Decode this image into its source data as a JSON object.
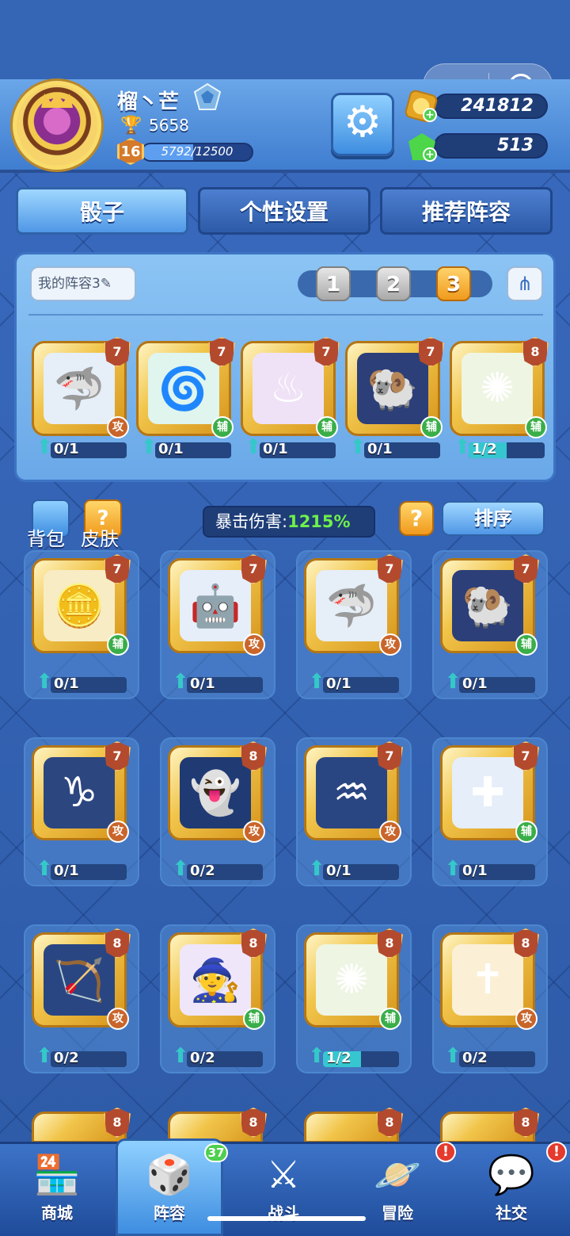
{
  "header": {
    "player_name": "榴丶芒",
    "trophies": "5658",
    "level": "16",
    "xp_text": "5792/12500",
    "xp_fraction": 0.4634,
    "coins": "241812",
    "gems": "513",
    "capsule_dots": "•••"
  },
  "tabs": [
    {
      "label": "骰子"
    },
    {
      "label": "个性设置"
    },
    {
      "label": "推荐阵容"
    }
  ],
  "lineup": {
    "my_lineup_label": "我的阵容3✎",
    "slots": [
      "1",
      "2",
      "3"
    ],
    "active_slot": "3",
    "cards": [
      {
        "icon": "🦈",
        "bg": "#e6eef8",
        "level": "7",
        "role": "攻",
        "progress": "0/1",
        "fill": 0
      },
      {
        "icon": "🌀",
        "bg": "#dff5ee",
        "level": "7",
        "role": "辅",
        "progress": "0/1",
        "fill": 0
      },
      {
        "icon": "♨",
        "bg": "#efe2f7",
        "level": "7",
        "role": "辅",
        "progress": "0/1",
        "fill": 0
      },
      {
        "icon": "🐏",
        "bg": "#2c3f78",
        "level": "7",
        "role": "辅",
        "progress": "0/1",
        "fill": 0
      },
      {
        "icon": "✺",
        "bg": "#eef5e3",
        "level": "8",
        "role": "辅",
        "progress": "1/2",
        "fill": 0.5
      }
    ]
  },
  "toolbar": {
    "bag_label": "背包",
    "skin_label": "皮肤",
    "crit_label": "暴击伤害:",
    "crit_value": "1215%",
    "help_label": "?",
    "sort_label": "排序"
  },
  "collection": [
    {
      "icon": "🪙",
      "bg": "#f8ecc4",
      "level": "7",
      "role": "辅",
      "progress": "0/1",
      "fill": 0
    },
    {
      "icon": "🤖",
      "bg": "#e6eefa",
      "level": "7",
      "role": "攻",
      "progress": "0/1",
      "fill": 0
    },
    {
      "icon": "🦈",
      "bg": "#e6eef8",
      "level": "7",
      "role": "攻",
      "progress": "0/1",
      "fill": 0
    },
    {
      "icon": "🐏",
      "bg": "#2c3f78",
      "level": "7",
      "role": "辅",
      "progress": "0/1",
      "fill": 0
    },
    {
      "icon": "♑",
      "bg": "#2c4680",
      "level": "7",
      "role": "攻",
      "progress": "0/1",
      "fill": 0
    },
    {
      "icon": "👻",
      "bg": "#203a74",
      "level": "8",
      "role": "攻",
      "progress": "0/2",
      "fill": 0
    },
    {
      "icon": "♒",
      "bg": "#2a4682",
      "level": "7",
      "role": "攻",
      "progress": "0/1",
      "fill": 0
    },
    {
      "icon": "✚",
      "bg": "#e6eefa",
      "level": "7",
      "role": "辅",
      "progress": "0/1",
      "fill": 0
    },
    {
      "icon": "🏹",
      "bg": "#2a4682",
      "level": "8",
      "role": "攻",
      "progress": "0/2",
      "fill": 0
    },
    {
      "icon": "🧙",
      "bg": "#efe6fa",
      "level": "8",
      "role": "辅",
      "progress": "0/2",
      "fill": 0
    },
    {
      "icon": "✺",
      "bg": "#eef5e3",
      "level": "8",
      "role": "辅",
      "progress": "1/2",
      "fill": 0.5
    },
    {
      "icon": "✝",
      "bg": "#fbf0d6",
      "level": "8",
      "role": "攻",
      "progress": "0/2",
      "fill": 0
    }
  ],
  "partial_row_levels": [
    "8",
    "8",
    "8",
    "8"
  ],
  "nav": [
    {
      "label": "商城",
      "icon": "🏪"
    },
    {
      "label": "阵容",
      "icon": "🎲"
    },
    {
      "label": "战斗",
      "icon": "⚔"
    },
    {
      "label": "冒险",
      "icon": "🪐"
    },
    {
      "label": "社交",
      "icon": "💬"
    }
  ],
  "nav_badge_count": "37",
  "nav_alert": "!"
}
